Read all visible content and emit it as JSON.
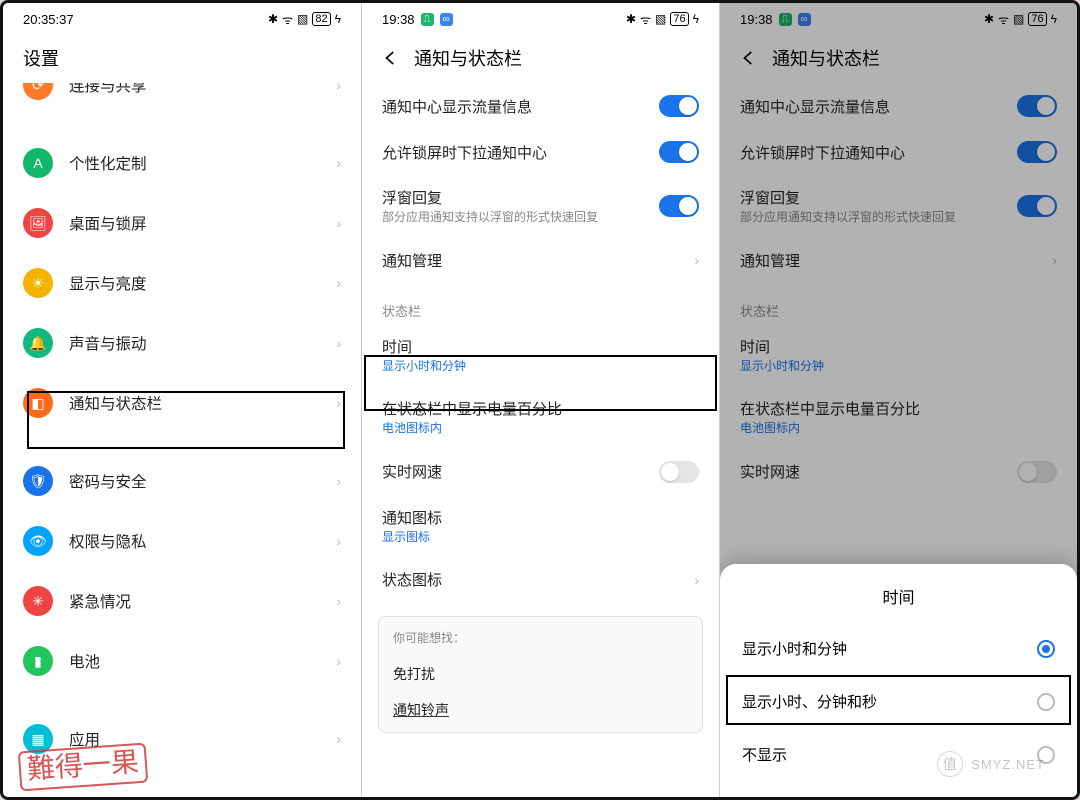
{
  "phone1": {
    "status": {
      "time": "20:35:37",
      "bt": "✱",
      "wifi": "ᯤ",
      "vib": "▧",
      "batt": "82",
      "bolt": "ϟ"
    },
    "title": "设置",
    "rows": [
      {
        "id": "connect",
        "label": "连接与共享",
        "color": "#ff7a29",
        "glyph": "⟳"
      },
      {
        "id": "personal",
        "label": "个性化定制",
        "color": "#12b76a",
        "glyph": "A"
      },
      {
        "id": "desktop",
        "label": "桌面与锁屏",
        "color": "#ef4444",
        "glyph": "🖼"
      },
      {
        "id": "display",
        "label": "显示与亮度",
        "color": "#f5b301",
        "glyph": "☀"
      },
      {
        "id": "sound",
        "label": "声音与振动",
        "color": "#10b981",
        "glyph": "🔔"
      },
      {
        "id": "notif",
        "label": "通知与状态栏",
        "color": "#ff6b1a",
        "glyph": "◧"
      },
      {
        "id": "security",
        "label": "密码与安全",
        "color": "#1a73e8",
        "glyph": "🛡"
      },
      {
        "id": "privacy",
        "label": "权限与隐私",
        "color": "#00a3ff",
        "glyph": "👁"
      },
      {
        "id": "sos",
        "label": "紧急情况",
        "color": "#ef4444",
        "glyph": "✳"
      },
      {
        "id": "battery",
        "label": "电池",
        "color": "#22c55e",
        "glyph": "▮"
      },
      {
        "id": "apps",
        "label": "应用",
        "color": "#00bcd4",
        "glyph": "▦"
      }
    ]
  },
  "phone2": {
    "status": {
      "time": "19:38",
      "bt": "✱",
      "wifi": "ᯤ",
      "vib": "▧",
      "batt": "76",
      "bolt": "ϟ"
    },
    "title": "通知与状态栏",
    "rows_a": [
      {
        "id": "traffic",
        "label": "通知中心显示流量信息",
        "toggle": "on"
      },
      {
        "id": "lock",
        "label": "允许锁屏时下拉通知中心",
        "toggle": "on"
      },
      {
        "id": "float",
        "label": "浮窗回复",
        "sub": "部分应用通知支持以浮窗的形式快速回复",
        "toggle": "on"
      },
      {
        "id": "manage",
        "label": "通知管理",
        "chev": true
      }
    ],
    "section": "状态栏",
    "rows_b": [
      {
        "id": "time",
        "label": "时间",
        "sub": "显示小时和分钟",
        "blue": true
      },
      {
        "id": "batt",
        "label": "在状态栏中显示电量百分比",
        "sub": "电池图标内",
        "blue": true
      },
      {
        "id": "speed",
        "label": "实时网速",
        "toggle": "off"
      },
      {
        "id": "nicon",
        "label": "通知图标",
        "sub": "显示图标",
        "blue": true
      },
      {
        "id": "sicon",
        "label": "状态图标",
        "chev": true
      }
    ],
    "suggest": {
      "hdr": "你可能想找：",
      "items": [
        "免打扰",
        "通知铃声"
      ]
    }
  },
  "phone3": {
    "status": {
      "time": "19:38",
      "bt": "✱",
      "wifi": "ᯤ",
      "vib": "▧",
      "batt": "76",
      "bolt": "ϟ"
    },
    "title": "通知与状态栏",
    "rows_a": [
      {
        "id": "traffic",
        "label": "通知中心显示流量信息",
        "toggle": "on"
      },
      {
        "id": "lock",
        "label": "允许锁屏时下拉通知中心",
        "toggle": "on"
      },
      {
        "id": "float",
        "label": "浮窗回复",
        "sub": "部分应用通知支持以浮窗的形式快速回复",
        "toggle": "on"
      },
      {
        "id": "manage",
        "label": "通知管理",
        "chev": true
      }
    ],
    "section": "状态栏",
    "rows_b": [
      {
        "id": "time",
        "label": "时间",
        "sub": "显示小时和分钟",
        "blue": true
      },
      {
        "id": "batt",
        "label": "在状态栏中显示电量百分比",
        "sub": "电池图标内",
        "blue": true
      },
      {
        "id": "speed",
        "label": "实时网速",
        "toggle": "off"
      }
    ],
    "sheet": {
      "title": "时间",
      "options": [
        {
          "label": "显示小时和分钟",
          "selected": true
        },
        {
          "label": "显示小时、分钟和秒",
          "selected": false
        },
        {
          "label": "不显示",
          "selected": false
        }
      ]
    }
  },
  "watermark_left": "難得一果",
  "watermark_right": {
    "glyph": "值",
    "text": "SMYZ.NET"
  }
}
